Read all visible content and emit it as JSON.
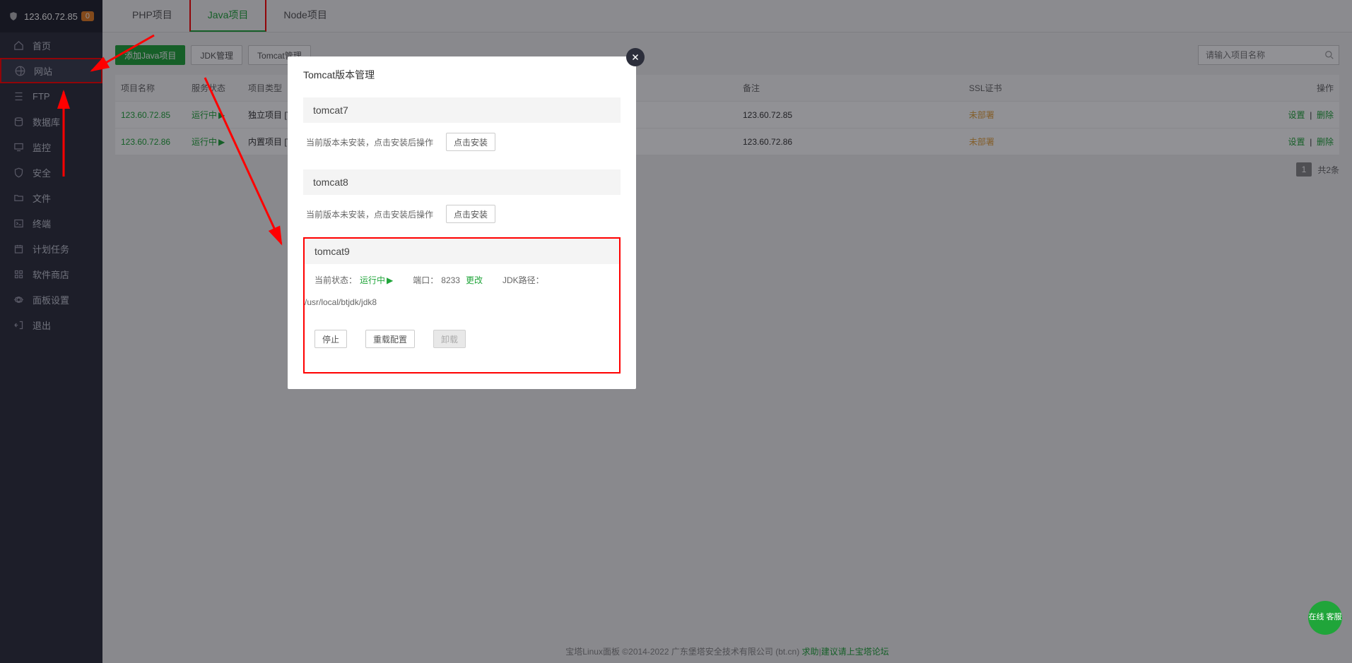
{
  "topbar": {
    "ip": "123.60.72.85",
    "badge": "0"
  },
  "sidebar": {
    "items": [
      {
        "label": "首页",
        "icon": "home-icon"
      },
      {
        "label": "网站",
        "icon": "globe-icon",
        "active": true,
        "highlight": true
      },
      {
        "label": "FTP",
        "icon": "ftp-icon"
      },
      {
        "label": "数据库",
        "icon": "database-icon"
      },
      {
        "label": "监控",
        "icon": "monitor-icon"
      },
      {
        "label": "安全",
        "icon": "security-icon"
      },
      {
        "label": "文件",
        "icon": "folder-icon"
      },
      {
        "label": "终端",
        "icon": "terminal-icon"
      },
      {
        "label": "计划任务",
        "icon": "schedule-icon"
      },
      {
        "label": "软件商店",
        "icon": "apps-icon"
      },
      {
        "label": "面板设置",
        "icon": "gear-icon"
      },
      {
        "label": "退出",
        "icon": "exit-icon"
      }
    ]
  },
  "tabs": [
    {
      "label": "PHP项目"
    },
    {
      "label": "Java项目",
      "active": true,
      "highlight": true
    },
    {
      "label": "Node项目"
    }
  ],
  "toolbar": {
    "add_label": "添加Java项目",
    "jdk_label": "JDK管理",
    "tomcat_label": "Tomcat管理",
    "tomcat_highlight": true,
    "search_placeholder": "请输入项目名称"
  },
  "columns": {
    "name": "项目名称",
    "status": "服务状态",
    "type": "项目类型",
    "remark": "备注",
    "ssl": "SSL证书",
    "ops": "操作"
  },
  "rows": [
    {
      "name": "123.60.72.85",
      "status": "运行中",
      "type": "独立项目 [To",
      "remark": "123.60.72.85",
      "ssl": "未部署",
      "op1": "设置",
      "op2": "删除"
    },
    {
      "name": "123.60.72.86",
      "status": "运行中",
      "type": "内置项目 [To",
      "remark": "123.60.72.86",
      "ssl": "未部署",
      "op1": "设置",
      "op2": "删除"
    }
  ],
  "pager": {
    "page": "1",
    "total": "共2条"
  },
  "modal": {
    "title": "Tomcat版本管理",
    "not_installed_hint": "当前版本未安装，点击安装后操作",
    "click_install": "点击安装",
    "v7": {
      "name": "tomcat7"
    },
    "v8": {
      "name": "tomcat8"
    },
    "v9": {
      "name": "tomcat9",
      "status_label": "当前状态：",
      "status_value": "运行中",
      "port_label": "端口：",
      "port_value": "8233",
      "change": "更改",
      "jdk_label": "JDK路径：",
      "jdk_value": "/usr/local/btjdk/jdk8",
      "stop": "停止",
      "reload": "重载配置",
      "uninstall": "卸载"
    }
  },
  "footer": {
    "text": "宝塔Linux面板 ©2014-2022 广东堡塔安全技术有限公司 (bt.cn)   ",
    "link1": "求助",
    "sep": "|",
    "link2": "建议请上宝塔论坛"
  },
  "help": "在线\n客服"
}
